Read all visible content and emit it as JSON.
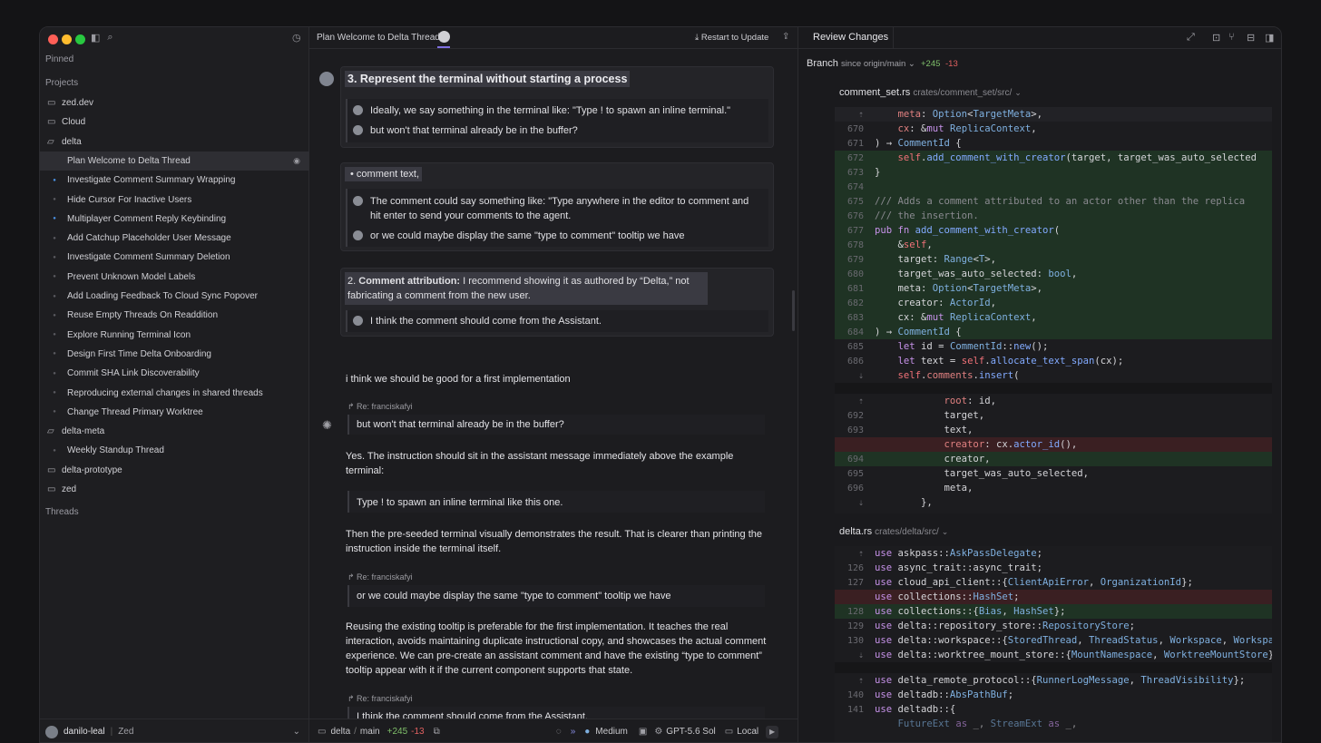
{
  "colors": {
    "red": "#ff5f57",
    "yellow": "#febc2e",
    "green": "#28c840",
    "accent_blue": "#4a90e2",
    "added": "#7fbf6a",
    "removed": "#e06060"
  },
  "sidebar": {
    "pinned_label": "Pinned",
    "projects_label": "Projects",
    "threads_label": "Threads",
    "items": [
      {
        "kind": "folder",
        "label": "zed.dev",
        "icon": "folder-icon"
      },
      {
        "kind": "folder",
        "label": "Cloud",
        "icon": "folder-icon"
      },
      {
        "kind": "folder-open",
        "label": "delta",
        "icon": "folder-open-icon"
      },
      {
        "kind": "thread",
        "label": "Plan Welcome to Delta Thread",
        "active": true,
        "dot": "none"
      },
      {
        "kind": "thread",
        "label": "Investigate Comment Summary Wrapping",
        "dot": "blue"
      },
      {
        "kind": "thread",
        "label": "Hide Cursor For Inactive Users",
        "dot": "gray"
      },
      {
        "kind": "thread",
        "label": "Multiplayer Comment Reply Keybinding",
        "dot": "blue"
      },
      {
        "kind": "thread",
        "label": "Add Catchup Placeholder User Message",
        "dot": "gray"
      },
      {
        "kind": "thread",
        "label": "Investigate Comment Summary Deletion",
        "dot": "gray"
      },
      {
        "kind": "thread",
        "label": "Prevent Unknown Model Labels",
        "dot": "gray"
      },
      {
        "kind": "thread",
        "label": "Add Loading Feedback To Cloud Sync Popover",
        "dot": "gray"
      },
      {
        "kind": "thread",
        "label": "Reuse Empty Threads On Readdition",
        "dot": "gray"
      },
      {
        "kind": "thread",
        "label": "Explore Running Terminal Icon",
        "dot": "gray"
      },
      {
        "kind": "thread",
        "label": "Design First Time Delta Onboarding",
        "dot": "gray"
      },
      {
        "kind": "thread",
        "label": "Commit SHA Link Discoverability",
        "dot": "gray"
      },
      {
        "kind": "thread",
        "label": "Reproducing external changes in shared threads",
        "dot": "gray"
      },
      {
        "kind": "thread",
        "label": "Change Thread Primary Worktree",
        "dot": "gray"
      },
      {
        "kind": "folder-open",
        "label": "delta-meta",
        "icon": "folder-open-icon"
      },
      {
        "kind": "thread",
        "label": "Weekly Standup Thread",
        "dot": "gray"
      },
      {
        "kind": "folder",
        "label": "delta-prototype",
        "icon": "folder-icon"
      },
      {
        "kind": "folder",
        "label": "zed",
        "icon": "folder-icon"
      }
    ],
    "footer": {
      "user": "danilo-leal",
      "app": "Zed"
    }
  },
  "center": {
    "title": "Plan Welcome to Delta Thread",
    "restart_label": "Restart to Update",
    "card1": {
      "heading": "3. Represent the terminal without starting a process",
      "q1": "Ideally, we say something in the terminal like: \"Type ! to spawn an inline terminal.\"",
      "q2": "but won't that terminal already be in the buffer?"
    },
    "card2": {
      "bullet": "comment text,",
      "q1": "The comment could say something like: \"Type anywhere in the editor to comment and hit enter to send your comments to the agent.",
      "q2": "or we could maybe display the same \"type to comment\" tooltip we have"
    },
    "card3": {
      "bold": "Comment attribution:",
      "prefix": "2.",
      "rest": "I recommend showing it as authored by “Delta,” not fabricating a comment from the new user.",
      "q1": "I think the comment should come from the Assistant."
    },
    "user_msg": "i think we should be good for a first implementation",
    "re1": "Re: franciskafyi",
    "re1_quote": "but won't that terminal already be in the buffer?",
    "p1": "Yes. The instruction should sit in the assistant message immediately above the example terminal:",
    "code_quote": "Type ! to spawn an inline terminal like this one.",
    "p2": "Then the pre-seeded terminal visually demonstrates the result. That is clearer than printing the instruction inside the terminal itself.",
    "re2": "Re: franciskafyi",
    "re2_quote": "or we could maybe display the same \"type to comment\" tooltip we have",
    "p3": "Reusing the existing tooltip is preferable for the first implementation. It teaches the real interaction, avoids maintaining duplicate instructional copy, and showcases the actual comment experience. We can pre-create an assistant comment and have the existing “type to comment” tooltip appear with it if the current component supports that state.",
    "re3": "Re: franciskafyi",
    "re3_quote": "I think the comment should come from the Assistant.",
    "footer": {
      "repo": "delta",
      "branch": "main",
      "added": "+245",
      "removed": "-13",
      "effort": "Medium",
      "model": "GPT-5.6 Sol",
      "location": "Local"
    }
  },
  "right": {
    "title": "Review Changes",
    "branch_label": "Branch",
    "branch_since": "since origin/main",
    "added": "+245",
    "removed": "-13",
    "file1": {
      "name": "comment_set.rs",
      "path": "crates/comment_set/src/"
    },
    "file2": {
      "name": "delta.rs",
      "path": "crates/delta/src/"
    }
  }
}
